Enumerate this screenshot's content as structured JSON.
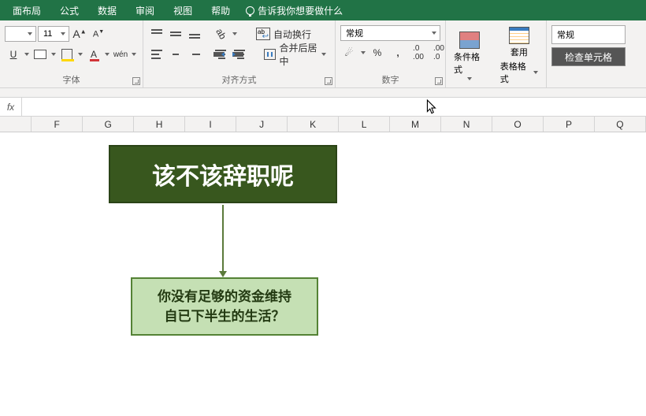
{
  "menu": {
    "items": [
      "面布局",
      "公式",
      "数据",
      "审阅",
      "视图",
      "帮助"
    ],
    "tell_me": "告诉我你想要做什么"
  },
  "ribbon": {
    "font": {
      "size": "11",
      "increase_tip": "A",
      "decrease_tip": "A",
      "underline": "U",
      "wen": "wén",
      "group_label": "字体"
    },
    "align": {
      "wrap_label": "自动换行",
      "merge_label": "合并后居中",
      "group_label": "对齐方式"
    },
    "number": {
      "format": "常规",
      "group_label": "数字"
    },
    "styles": {
      "cond_label": "条件格式",
      "table_label1": "套用",
      "table_label2": "表格格式",
      "normal": "常规",
      "check_cell": "检查单元格"
    }
  },
  "formula_bar": {
    "fx": "fx",
    "value": ""
  },
  "columns": [
    "",
    "F",
    "G",
    "H",
    "I",
    "J",
    "K",
    "L",
    "M",
    "N",
    "O",
    "P",
    "Q"
  ],
  "shapes": {
    "title": "该不该辞职呢",
    "sub_line1": "你没有足够的资金维持",
    "sub_line2": "自已下半生的生活？"
  }
}
